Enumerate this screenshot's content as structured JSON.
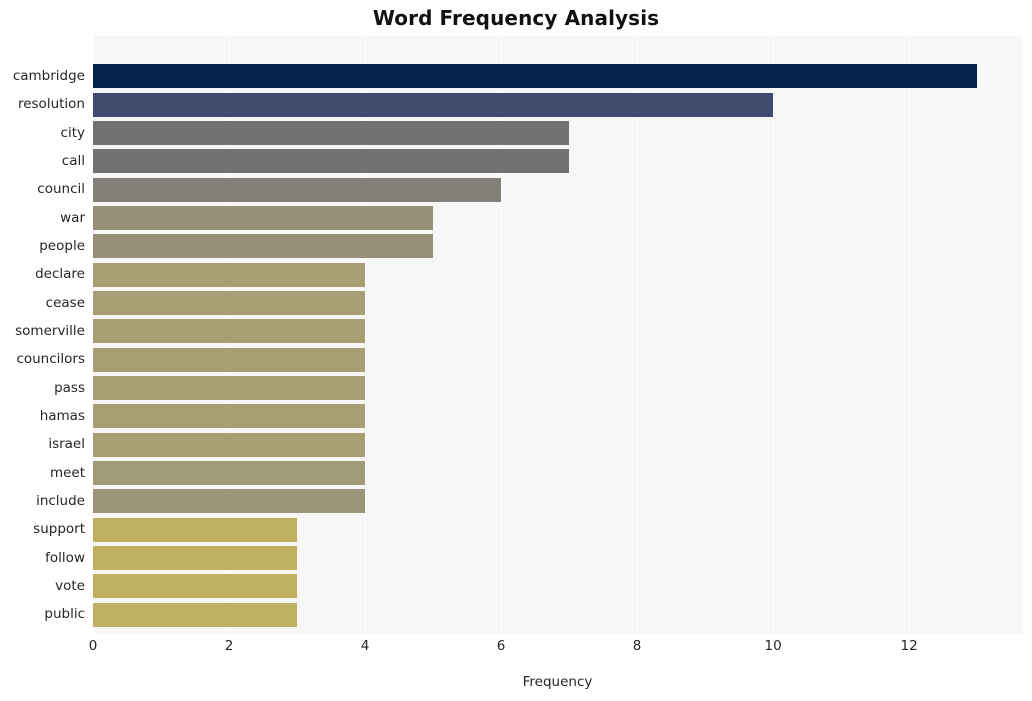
{
  "chart_data": {
    "type": "bar",
    "orientation": "horizontal",
    "title": "Word Frequency Analysis",
    "xlabel": "Frequency",
    "ylabel": "",
    "categories": [
      "cambridge",
      "resolution",
      "city",
      "call",
      "council",
      "war",
      "people",
      "declare",
      "cease",
      "somerville",
      "councilors",
      "pass",
      "hamas",
      "israel",
      "meet",
      "include",
      "support",
      "follow",
      "vote",
      "public"
    ],
    "values": [
      13,
      10,
      7,
      7,
      6,
      5,
      5,
      4,
      4,
      4,
      4,
      4,
      4,
      4,
      4,
      4,
      3,
      3,
      3,
      3
    ],
    "bar_colors": [
      "#04224d",
      "#414b6e",
      "#727273",
      "#727273",
      "#83807a",
      "#97917a",
      "#97917a",
      "#a79e74",
      "#a79e74",
      "#a79e74",
      "#a79e74",
      "#a79e74",
      "#a79e74",
      "#a79e74",
      "#a09a78",
      "#9b9679",
      "#c0b162",
      "#c0b162",
      "#c0b162",
      "#c0b162"
    ],
    "xlim": [
      0,
      13.66
    ],
    "ylim_note": "categorical, ordered descending by frequency",
    "xticks": [
      0,
      2,
      4,
      6,
      8,
      10,
      12
    ],
    "xticklabels": [
      "0",
      "2",
      "4",
      "6",
      "8",
      "10",
      "12"
    ],
    "grid": "vertical gridlines only, white on light gray panel",
    "legend": "none",
    "plot_background": "#f7f7f7",
    "figure_background": "#ffffff",
    "text_color": "#262626",
    "title_color": "#121212"
  }
}
